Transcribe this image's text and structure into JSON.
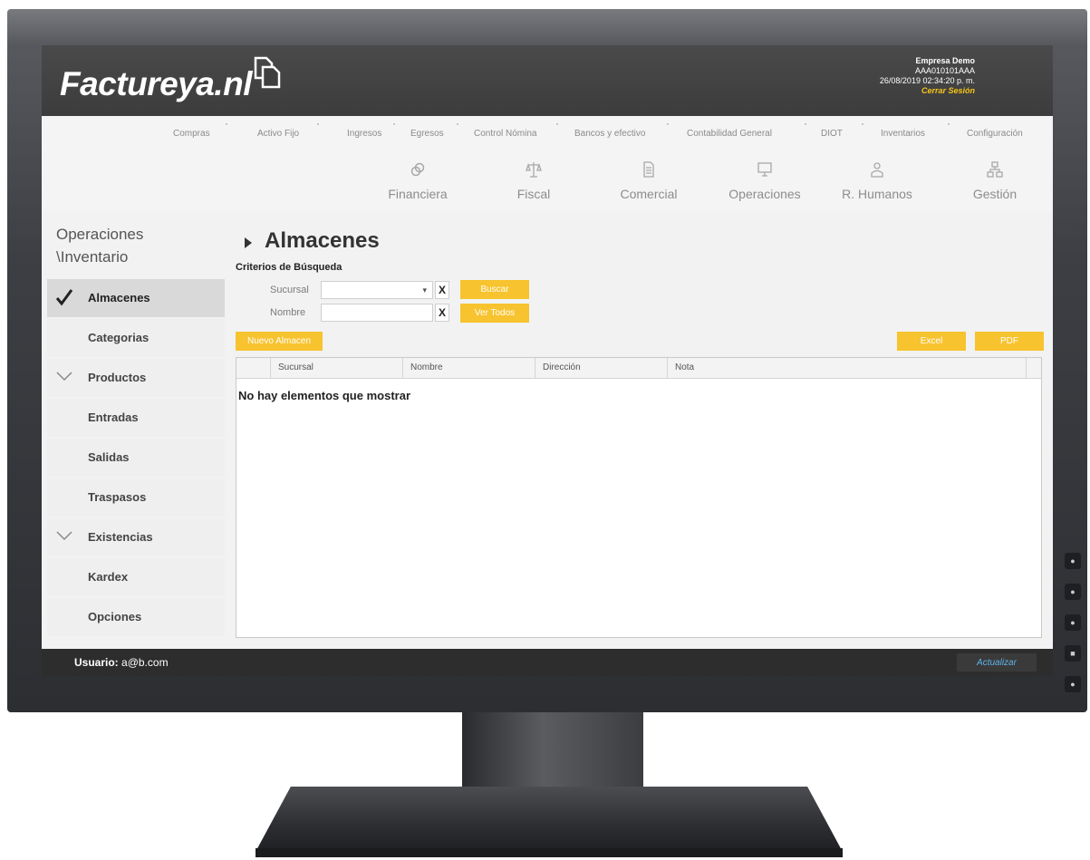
{
  "app": {
    "logo_text": "Factureya.nl",
    "company_name": "Empresa Demo",
    "rfc": "AAA010101AAA",
    "datetime": "26/08/2019 02:34:20 p. m.",
    "logout": "Cerrar Sesión"
  },
  "top_menu": [
    "Compras",
    "Activo Fijo",
    "Ingresos",
    "Egresos",
    "Control Nómina",
    "Bancos y efectivo",
    "Contabilidad General",
    "DIOT",
    "Inventarios",
    "Configuración"
  ],
  "modules": [
    {
      "label": "Financiera",
      "icon": "link-icon"
    },
    {
      "label": "Fiscal",
      "icon": "scale-icon"
    },
    {
      "label": "Comercial",
      "icon": "document-icon"
    },
    {
      "label": "Operaciones",
      "icon": "monitor-icon"
    },
    {
      "label": "R. Humanos",
      "icon": "person-icon"
    },
    {
      "label": "Gestión",
      "icon": "org-chart-icon"
    }
  ],
  "sidebar": {
    "title": "Operaciones \\Inventario",
    "items": [
      {
        "label": "Almacenes",
        "state": "active-check"
      },
      {
        "label": "Categorias",
        "state": "none"
      },
      {
        "label": "Productos",
        "state": "expand-chevron"
      },
      {
        "label": "Entradas",
        "state": "none"
      },
      {
        "label": "Salidas",
        "state": "none"
      },
      {
        "label": "Traspasos",
        "state": "none"
      },
      {
        "label": "Existencias",
        "state": "expand-chevron"
      },
      {
        "label": "Kardex",
        "state": "none"
      },
      {
        "label": "Opciones",
        "state": "none"
      }
    ]
  },
  "content": {
    "title": "Almacenes",
    "criteria_label": "Criterios de Búsqueda",
    "sucursal_label": "Sucursal",
    "sucursal_value": "",
    "nombre_label": "Nombre",
    "nombre_value": "",
    "clear_symbol": "X",
    "buscar_button": "Buscar",
    "ver_todos_button": "Ver Todos",
    "nuevo_button": "Nuevo Almacen",
    "excel_button": "Excel",
    "pdf_button": "PDF",
    "table": {
      "columns": [
        "",
        "Sucursal",
        "Nombre",
        "Dirección",
        "Nota"
      ],
      "rows": [],
      "empty_message": "No hay elementos que mostrar"
    }
  },
  "status": {
    "user_label": "Usuario:",
    "user_value": "a@b.com",
    "refresh_button": "Actualizar"
  },
  "colors": {
    "accent_yellow": "#f7c32e",
    "header_dark": "#3f3f3f",
    "statusbar_dark": "#2d2d2d",
    "link_blue": "#5fb2e6"
  }
}
